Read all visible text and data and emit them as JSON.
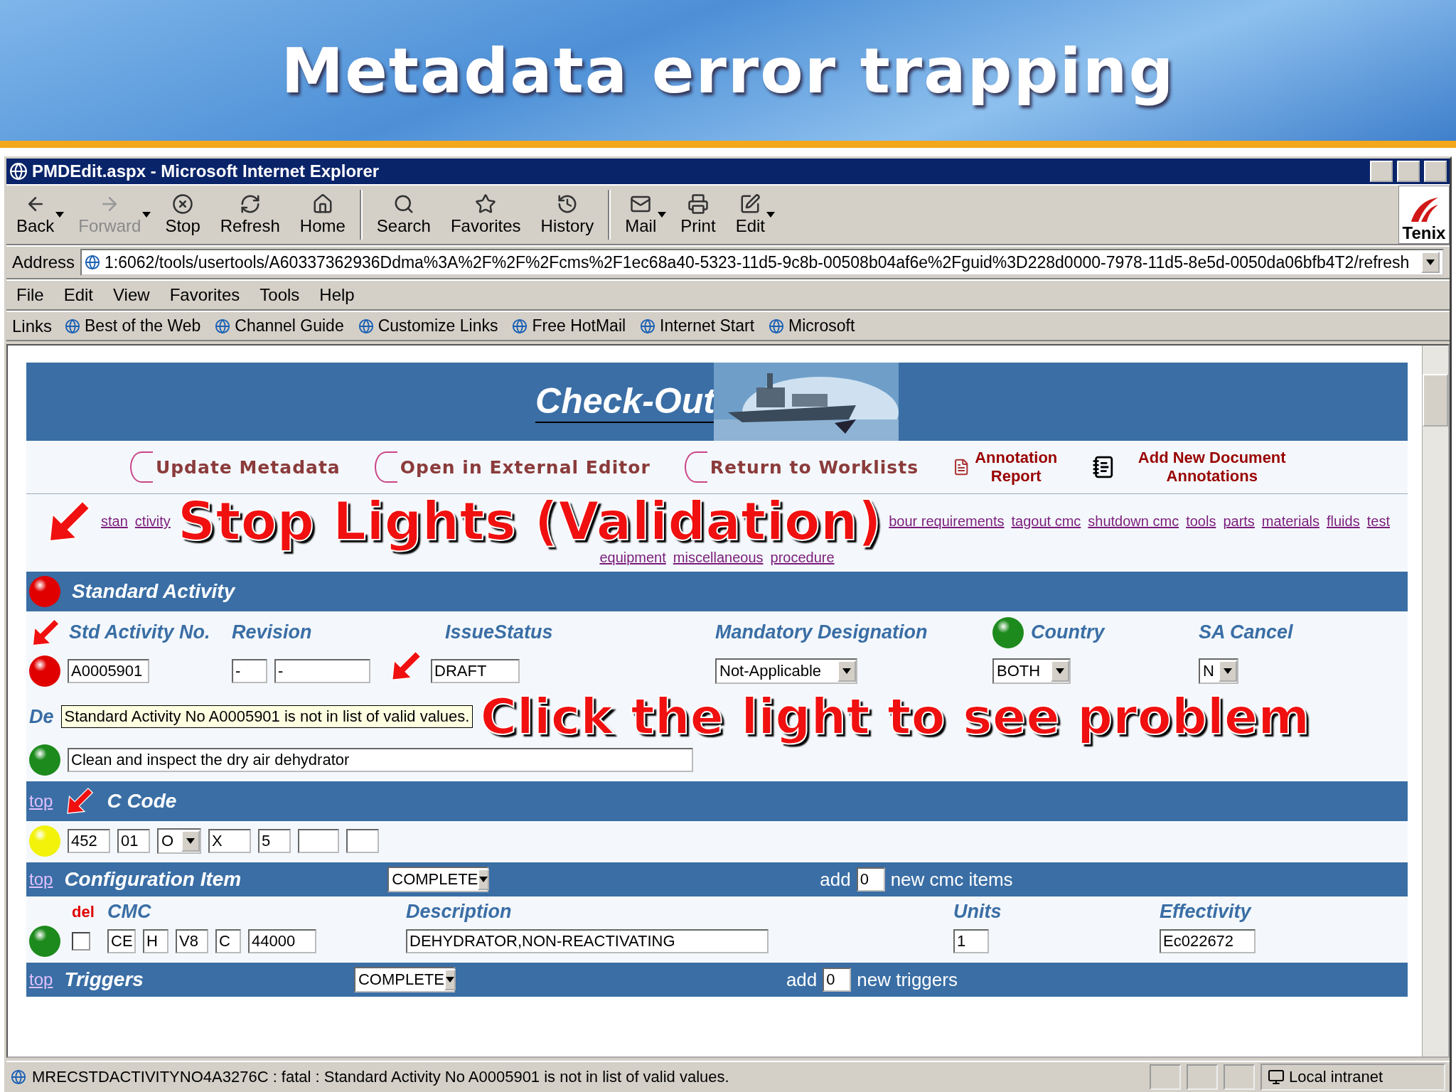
{
  "slide_title": "Metadata error trapping",
  "window": {
    "title": "PMDEdit.aspx - Microsoft Internet Explorer"
  },
  "toolbar": [
    {
      "kind": "back",
      "label": "Back",
      "disabled": false,
      "dropdown": true
    },
    {
      "kind": "forward",
      "label": "Forward",
      "disabled": true,
      "dropdown": true
    },
    {
      "kind": "stop",
      "label": "Stop",
      "disabled": false,
      "dropdown": false
    },
    {
      "kind": "refresh",
      "label": "Refresh",
      "disabled": false,
      "dropdown": false
    },
    {
      "kind": "home",
      "label": "Home",
      "disabled": false,
      "dropdown": false
    },
    {
      "kind": "search",
      "label": "Search",
      "disabled": false,
      "dropdown": false
    },
    {
      "kind": "favorites",
      "label": "Favorites",
      "disabled": false,
      "dropdown": false
    },
    {
      "kind": "history",
      "label": "History",
      "disabled": false,
      "dropdown": false
    },
    {
      "kind": "mail",
      "label": "Mail",
      "disabled": false,
      "dropdown": true
    },
    {
      "kind": "print",
      "label": "Print",
      "disabled": false,
      "dropdown": false
    },
    {
      "kind": "edit",
      "label": "Edit",
      "disabled": false,
      "dropdown": true
    }
  ],
  "brand": "Tenix",
  "address": {
    "label": "Address",
    "value": "1:6062/tools/usertools/A60337362936Ddma%3A%2F%2F%2Fcms%2F1ec68a40-5323-11d5-9c8b-00508b04af6e%2Fguid%3D228d0000-7978-11d5-8e5d-0050da06bfb4T2/refresh"
  },
  "menu": [
    "File",
    "Edit",
    "View",
    "Favorites",
    "Tools",
    "Help"
  ],
  "links_bar": {
    "label": "Links",
    "items": [
      "Best of the Web",
      "Channel Guide",
      "Customize Links",
      "Free HotMail",
      "Internet Start",
      "Microsoft"
    ]
  },
  "page": {
    "banner_title": "Check-Out",
    "actions": [
      {
        "kind": "circle",
        "label": "Update Metadata"
      },
      {
        "kind": "circle",
        "label": "Open in External Editor"
      },
      {
        "kind": "circle",
        "label": "Return to Worklists"
      },
      {
        "kind": "document",
        "label": "Annotation Report"
      },
      {
        "kind": "notes",
        "label": "Add New Document Annotations"
      }
    ],
    "section_links_before": [
      "stan",
      "ctivity"
    ],
    "callout_top": "Stop Lights (Validation)",
    "section_links_after": [
      "bour requirements",
      "tagout cmc",
      "shutdown cmc",
      "tools",
      "parts",
      "materials",
      "fluids",
      "test",
      "equipment",
      "miscellaneous",
      "procedure"
    ],
    "standard_activity": {
      "title": "Standard Activity",
      "color": "#e00000",
      "fields": [
        {
          "label": "Std Activity No.",
          "color": "#e00000",
          "inputs": [
            {
              "kind": "input",
              "value": "A0005901"
            }
          ]
        },
        {
          "label": "Revision",
          "inputs": [
            {
              "kind": "input",
              "value": "-"
            },
            {
              "kind": "input",
              "value": "-"
            }
          ]
        },
        {
          "label": "IssueStatus",
          "inputs": [
            {
              "kind": "input",
              "value": "DRAFT"
            }
          ]
        },
        {
          "label": "Mandatory Designation",
          "inputs": [
            {
              "kind": "select",
              "value": "Not-Applicable"
            }
          ]
        },
        {
          "label": "Country",
          "color": "#1d8a1d",
          "inputs": [
            {
              "kind": "select",
              "value": "BOTH"
            }
          ]
        },
        {
          "label": "SA Cancel",
          "inputs": [
            {
              "kind": "select",
              "value": "N"
            }
          ]
        }
      ],
      "description_label": "De",
      "tooltip": "Standard Activity No A0005901 is not in list of valid values.",
      "callout": "Click the light to see problem",
      "description": {
        "color": "#1d8a1d",
        "value": "Clean and inspect the dry air dehydrator"
      }
    },
    "kc_code": {
      "top_link": "top",
      "title": "C Code",
      "color": "#f2f20a",
      "inputs": [
        {
          "kind": "input",
          "value": "452"
        },
        {
          "kind": "input",
          "value": "01"
        },
        {
          "kind": "select",
          "value": "O"
        },
        {
          "kind": "input",
          "value": "X"
        },
        {
          "kind": "input",
          "value": "5"
        },
        {
          "kind": "input"
        },
        {
          "kind": "input"
        }
      ]
    },
    "configuration": {
      "top_link": "top",
      "title": "Configuration Item",
      "select": "COMPLETE",
      "add_label": "add",
      "add_value": "0",
      "suffix": "new cmc items"
    },
    "cmc": {
      "headers": {
        "del": "del",
        "cmc": "CMC",
        "description": "Description",
        "units": "Units",
        "effectivity": "Effectivity"
      },
      "rows": [
        {
          "color": "#1d8a1d",
          "checked": false,
          "cmc": [
            "CE",
            "H",
            "V8",
            "C",
            "44000"
          ],
          "description": "DEHYDRATOR,NON-REACTIVATING",
          "units": "1",
          "effectivity": "Ec022672"
        }
      ]
    },
    "triggers": {
      "top_link": "top",
      "title": "Triggers",
      "select": "COMPLETE",
      "add_label": "add",
      "add_value": "0",
      "suffix": "new triggers"
    }
  },
  "status_bar": {
    "text": "MRECSTDACTIVITYNO4A3276C : fatal : Standard Activity No A0005901 is not in list of valid values.",
    "zone": "Local intranet"
  }
}
